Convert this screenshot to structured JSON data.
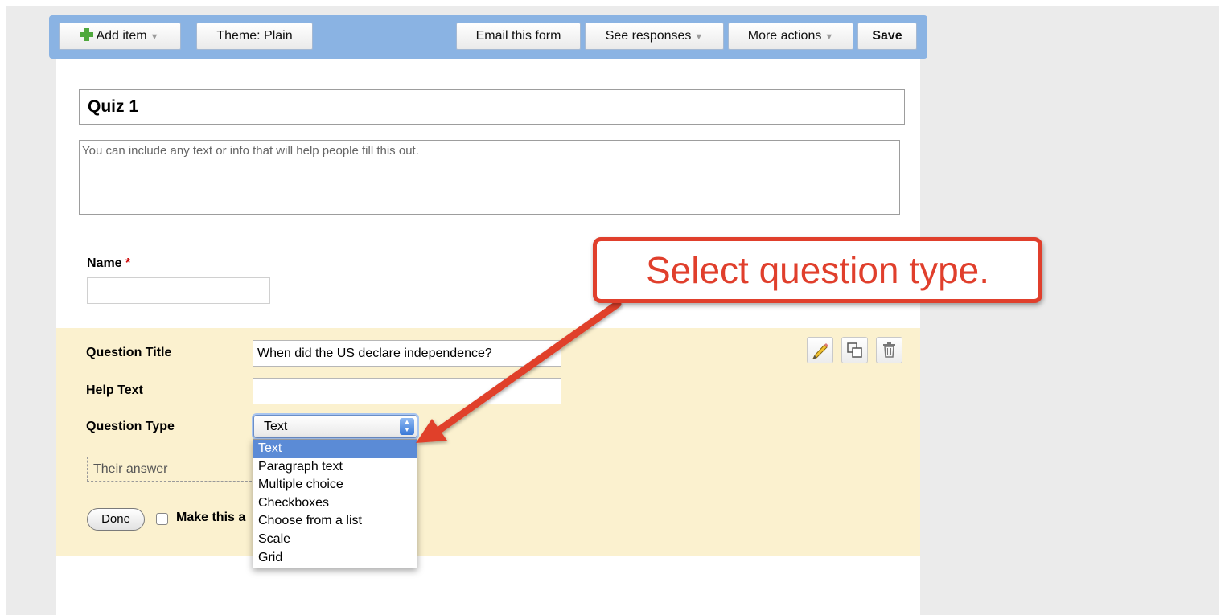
{
  "toolbar": {
    "add_item": "Add item",
    "theme": "Theme:  Plain",
    "email_form": "Email this form",
    "see_responses": "See responses",
    "more_actions": "More actions",
    "save": "Save"
  },
  "form": {
    "title": "Quiz 1",
    "description": "You can include any text or info that will help people fill this out."
  },
  "name_question": {
    "label": "Name",
    "required_marker": "*"
  },
  "question_editor": {
    "title_label": "Question Title",
    "title_value": "When did the US declare independence?",
    "help_label": "Help Text",
    "help_value": "",
    "type_label": "Question Type",
    "type_selected": "Text",
    "type_options": [
      "Text",
      "Paragraph text",
      "Multiple choice",
      "Checkboxes",
      "Choose from a list",
      "Scale",
      "Grid"
    ],
    "answer_preview": "Their answer",
    "done_label": "Done",
    "required_label": "Make this a"
  },
  "annotation": {
    "callout_text": "Select question type."
  },
  "colors": {
    "toolbar_bg": "#8ab3e3",
    "editor_bg": "#fbf1cf",
    "callout_red": "#e03f2c",
    "option_highlight": "#5b8bd6"
  },
  "icons": [
    "plus-icon",
    "caret-down-icon",
    "pencil-icon",
    "duplicate-icon",
    "trash-icon",
    "select-arrows-icon",
    "arrow-icon"
  ]
}
